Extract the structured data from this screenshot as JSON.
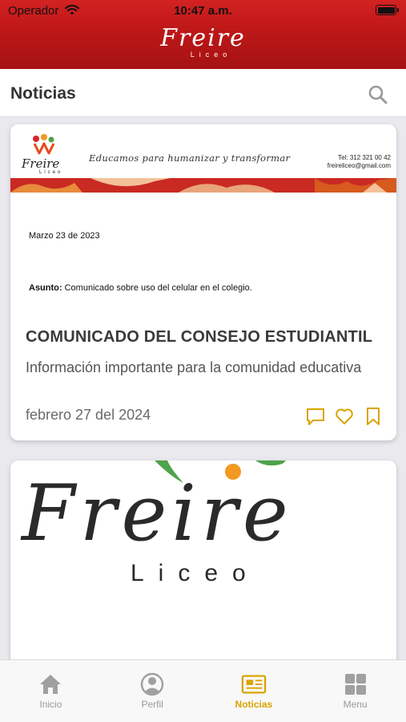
{
  "status_bar": {
    "carrier": "Operador",
    "time": "10:47 a.m."
  },
  "header": {
    "logo_main": "Freire",
    "logo_sub": "Liceo"
  },
  "page": {
    "title": "Noticias"
  },
  "colors": {
    "primary": "#c01818",
    "accent": "#d9a400",
    "inactive": "#9a9a9a"
  },
  "posts": [
    {
      "image": {
        "logo_main": "Freire",
        "logo_sub": "Liceo",
        "motto": "Educamos para humanizar y transformar",
        "phone": "Tel: 312 321 00 42",
        "email": "freireliceo@gmail.com",
        "date": "Marzo 23 de 2023",
        "subject_label": "Asunto:",
        "subject": "Comunicado sobre uso del celular en el colegio."
      },
      "title": "COMUNICADO DEL CONSEJO ESTUDIANTIL",
      "description": "Información importante para la comunidad educativa",
      "date": "febrero 27 del 2024",
      "actions": [
        "comment-icon",
        "heart-icon",
        "bookmark-icon"
      ]
    },
    {
      "image": {
        "logo_main": "Freire",
        "logo_sub": "Liceo"
      }
    }
  ],
  "tabbar": [
    {
      "label": "Inicio",
      "icon": "home-icon",
      "active": false
    },
    {
      "label": "Perfil",
      "icon": "profile-icon",
      "active": false
    },
    {
      "label": "Noticias",
      "icon": "newspaper-icon",
      "active": true
    },
    {
      "label": "Menu",
      "icon": "grid-icon",
      "active": false
    }
  ]
}
